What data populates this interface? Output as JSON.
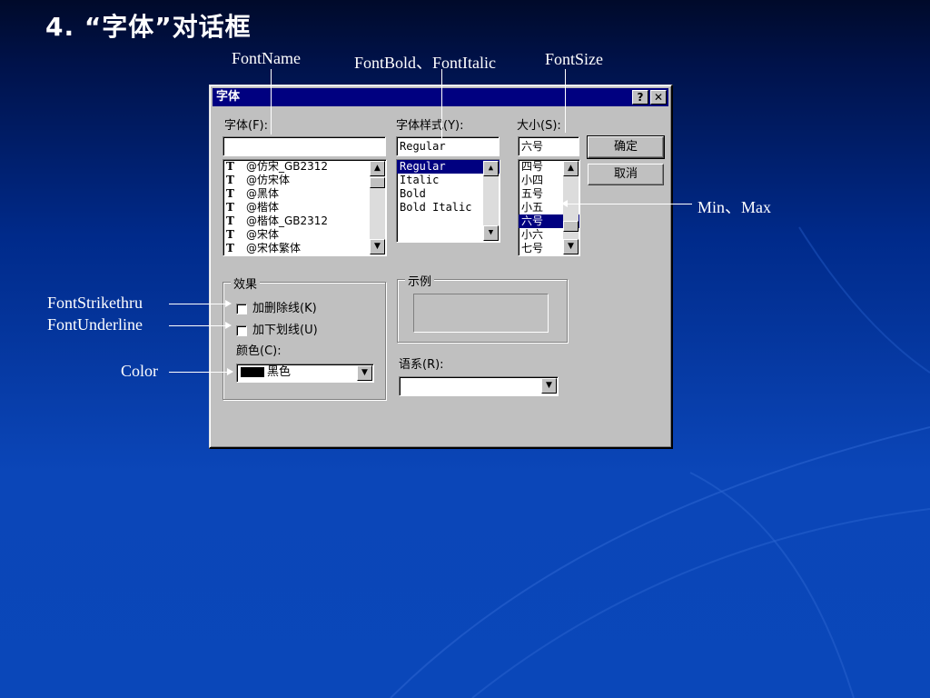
{
  "slide_title": "4. “字体”对话框",
  "annotations": {
    "font_name": "FontName",
    "bold_italic": "FontBold、FontItalic",
    "font_size": "FontSize",
    "min_max": "Min、Max",
    "strikethru": "FontStrikethru",
    "underline": "FontUnderline",
    "color": "Color"
  },
  "dialog": {
    "title": "字体",
    "help_button": "?",
    "close_button": "✕",
    "font_label": "字体(F):",
    "font_value": "",
    "font_list": [
      "@仿宋_GB2312",
      "@仿宋体",
      "@黑体",
      "@楷体",
      "@楷体_GB2312",
      "@宋体",
      "@宋体繁体"
    ],
    "font_list_icon": "truetype-icon",
    "style_label": "字体样式(Y):",
    "style_value": "Regular",
    "style_list": [
      "Regular",
      "Italic",
      "Bold",
      "Bold Italic"
    ],
    "style_selected": "Regular",
    "size_label": "大小(S):",
    "size_value": "六号",
    "size_list": [
      "四号",
      "小四",
      "五号",
      "小五",
      "六号",
      "小六",
      "七号"
    ],
    "size_selected": "六号",
    "ok_button": "确定",
    "cancel_button": "取消",
    "effects_group": "效果",
    "strike_label": "加删除线(K)",
    "underline_label": "加下划线(U)",
    "color_label": "颜色(C):",
    "color_value": "黑色",
    "color_swatch": "#000000",
    "sample_group": "示例",
    "script_label": "语系(R):",
    "script_value": ""
  },
  "colors": {
    "titlebar": "#000080",
    "dialog_face": "#c0c0c0",
    "selection": "#000080"
  }
}
